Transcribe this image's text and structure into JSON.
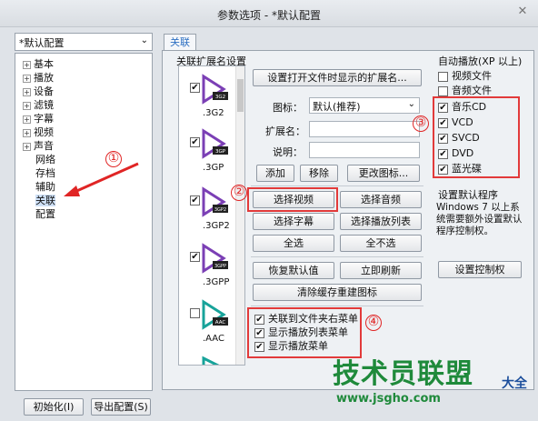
{
  "window": {
    "title": "参数选项 - *默认配置"
  },
  "preset": {
    "selected": "*默认配置"
  },
  "tree": {
    "items": [
      {
        "label": "基本",
        "expandable": true
      },
      {
        "label": "播放",
        "expandable": true
      },
      {
        "label": "设备",
        "expandable": true
      },
      {
        "label": "滤镜",
        "expandable": true
      },
      {
        "label": "字幕",
        "expandable": true
      },
      {
        "label": "视频",
        "expandable": true
      },
      {
        "label": "声音",
        "expandable": true
      },
      {
        "label": "网络",
        "expandable": false
      },
      {
        "label": "存档",
        "expandable": false
      },
      {
        "label": "辅助",
        "expandable": false
      },
      {
        "label": "关联",
        "expandable": false,
        "selected": true
      },
      {
        "label": "配置",
        "expandable": false
      }
    ]
  },
  "tab": {
    "label": "关联"
  },
  "ext_group": {
    "title": "关联扩展名设置",
    "items": [
      {
        "name": ".3G2",
        "badge": "3G2",
        "checked": true
      },
      {
        "name": ".3GP",
        "badge": "3GP",
        "checked": true
      },
      {
        "name": ".3GP2",
        "badge": "3GP2",
        "checked": true
      },
      {
        "name": ".3GPP",
        "badge": "3GPP",
        "checked": true
      },
      {
        "name": ".AAC",
        "badge": "AAC",
        "checked": false
      }
    ]
  },
  "buttons": {
    "set_ext_display": "设置打开文件时显示的扩展名...",
    "add": "添加",
    "remove": "移除",
    "change_icon": "更改图标...",
    "select_video": "选择视频",
    "select_audio": "选择音频",
    "select_subtitle": "选择字幕",
    "select_playlist": "选择播放列表",
    "select_all": "全选",
    "select_none": "全不选",
    "restore_default": "恢复默认值",
    "refresh_now": "立即刷新",
    "rebuild_icons": "清除缓存重建图标",
    "set_control": "设置控制权",
    "initialize": "初始化(I)",
    "export_config": "导出配置(S)"
  },
  "fields": {
    "icon_label": "图标：",
    "icon_value": "默认(推荐)",
    "ext_label": "扩展名：",
    "desc_label": "说明："
  },
  "context_menu_options": [
    {
      "label": "关联到文件夹右菜单",
      "checked": true
    },
    {
      "label": "显示播放列表菜单",
      "checked": true
    },
    {
      "label": "显示播放菜单",
      "checked": true
    }
  ],
  "autoplay": {
    "title": "自动播放(XP 以上)",
    "items": [
      {
        "label": "视频文件",
        "checked": false
      },
      {
        "label": "音频文件",
        "checked": false
      },
      {
        "label": "音乐CD",
        "checked": true
      },
      {
        "label": "VCD",
        "checked": true
      },
      {
        "label": "SVCD",
        "checked": true
      },
      {
        "label": "DVD",
        "checked": true
      },
      {
        "label": "蓝光碟",
        "checked": true
      }
    ]
  },
  "default_program": {
    "title": "设置默认程序",
    "description": "Windows 7 以上系统需要额外设置默认程序控制权。"
  },
  "annotations": [
    "①",
    "②",
    "③",
    "④"
  ],
  "watermark": {
    "brand": "技术员联盟",
    "url": "www.jsgho.com",
    "side": "大全"
  },
  "colors": {
    "accent": "#2c6fc2",
    "annotation": "#e02525",
    "watermark": "#1f8a3b",
    "icon_purple": "#7b3fb5",
    "icon_teal": "#17a39a"
  }
}
